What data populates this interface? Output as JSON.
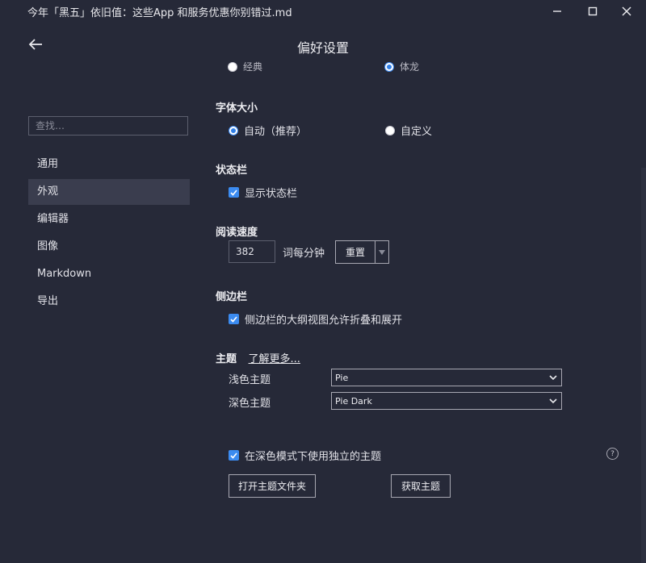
{
  "window": {
    "title": "今年「黑五」依旧值：这些App 和服务优惠你别错过.md",
    "icons": [
      "minimize-icon",
      "maximize-icon",
      "close-icon"
    ]
  },
  "header": {
    "title": "偏好设置",
    "back_icon": "arrow-left-icon"
  },
  "sidebar": {
    "search_placeholder": "查找…",
    "items": [
      {
        "label": "通用",
        "active": false
      },
      {
        "label": "外观",
        "active": true
      },
      {
        "label": "编辑器",
        "active": false
      },
      {
        "label": "图像",
        "active": false
      },
      {
        "label": "Markdown",
        "active": false
      },
      {
        "label": "导出",
        "active": false
      }
    ]
  },
  "main": {
    "clipped_options": {
      "left": "经典",
      "right": "体龙"
    },
    "font_size": {
      "heading": "字体大小",
      "options": [
        {
          "label": "自动（推荐）",
          "selected": true
        },
        {
          "label": "自定义",
          "selected": false
        }
      ]
    },
    "status_bar": {
      "heading": "状态栏",
      "checkbox_label": "显示状态栏",
      "checked": true
    },
    "reading_speed": {
      "heading": "阅读速度",
      "value": "382",
      "unit": "词每分钟",
      "reset_label": "重置",
      "dropdown_icon": "caret-down-icon"
    },
    "sidebar_section": {
      "heading": "侧边栏",
      "checkbox_label": "侧边栏的大纲视图允许折叠和展开",
      "checked": true
    },
    "theme": {
      "heading": "主题",
      "learn_more": "了解更多...",
      "light_label": "浅色主题",
      "light_value": "Pie",
      "dark_label": "深色主题",
      "dark_value": "Pie Dark",
      "separate_dark_label": "在深色模式下使用独立的主题",
      "separate_dark_checked": true,
      "open_folder_label": "打开主题文件夹",
      "get_themes_label": "获取主题",
      "help_icon": "question-circle-icon"
    }
  },
  "colors": {
    "background": "#262938",
    "sidebar_active": "#3a3d4e",
    "accent": "#3b8bf0",
    "border": "#a8a8b2"
  }
}
